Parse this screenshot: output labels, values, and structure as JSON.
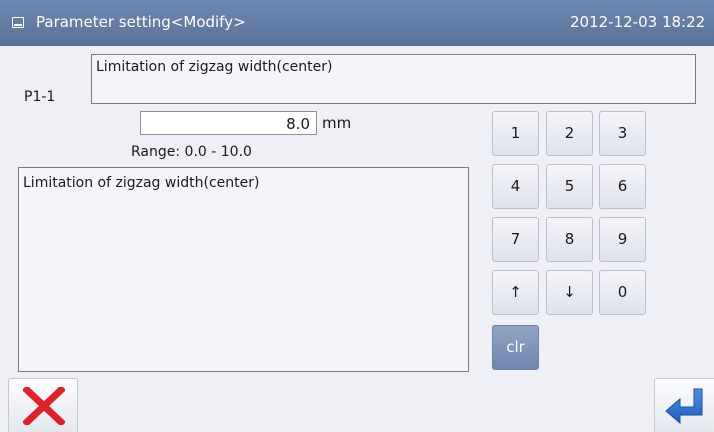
{
  "title_bar": {
    "icon": "app-window-icon",
    "title": "Parameter setting<Modify>",
    "datetime": "2012-12-03  18:22"
  },
  "parameter": {
    "code": "P1-1",
    "name": "Limitation of zigzag width(center)",
    "value": "8.0",
    "unit": "mm",
    "range": "Range: 0.0  -  10.0",
    "description": "Limitation of zigzag width(center)"
  },
  "keypad": {
    "keys": [
      "1",
      "2",
      "3",
      "4",
      "5",
      "6",
      "7",
      "8",
      "9",
      "↑",
      "↓",
      "0"
    ],
    "clear_label": "clr"
  },
  "footer": {
    "cancel_icon": "close-x-icon",
    "confirm_icon": "enter-return-icon"
  }
}
